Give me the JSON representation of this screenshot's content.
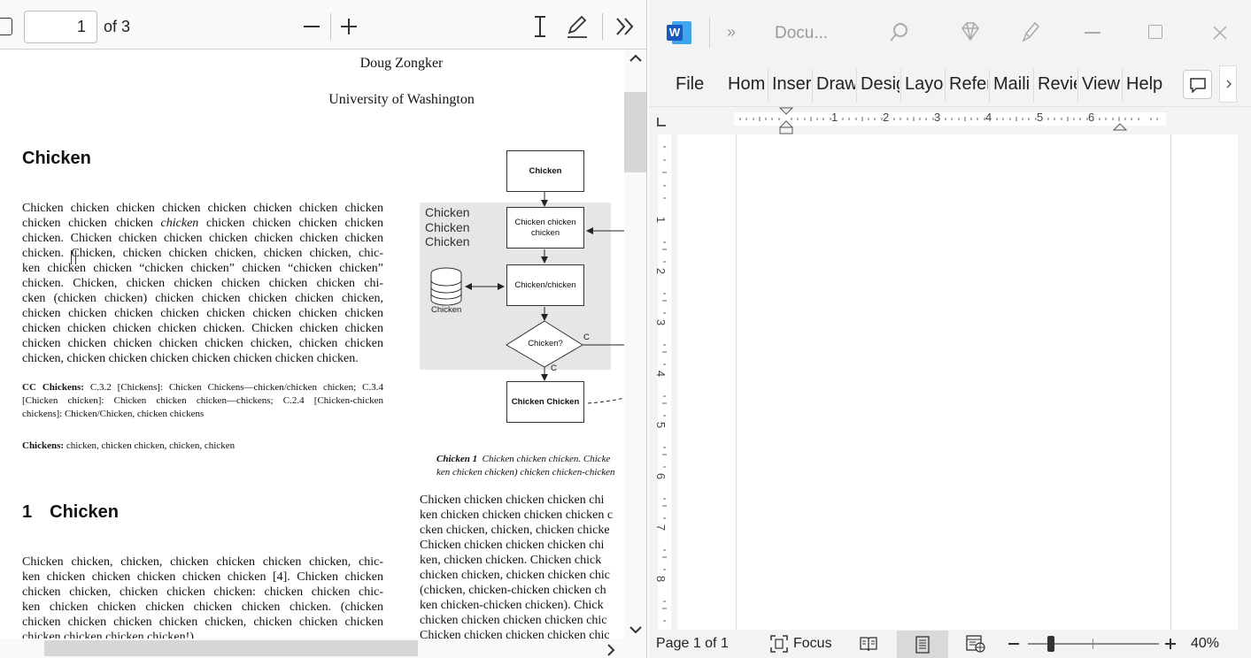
{
  "pdf_viewer": {
    "toolbar": {
      "page_number": "1",
      "page_total": "of 3"
    },
    "document": {
      "author": "Doug Zongker",
      "affiliation": "University of Washington",
      "heading_chicken": "Chicken",
      "abstract": {
        "lines": [
          "Chicken chicken chicken chicken chicken chicken chicken chicken",
          "chicken chicken chicken ",
          "chicken",
          " chicken chicken chicken chicken",
          "chicken. Chicken chicken chicken chicken chicken chicken chicken",
          "chicken. Chicken, chicken chicken chicken, chicken chicken, chic-",
          "ken chicken chicken “chicken chicken” chicken “chicken chicken”",
          "chicken.  Chicken, chicken chicken chicken chicken chicken chi-",
          "cken (chicken chicken) chicken chicken chicken chicken chicken,",
          "chicken chicken chicken chicken chicken chicken chicken chicken",
          "chicken chicken chicken chicken chicken. Chicken chicken chicken",
          "chicken chicken chicken chicken chicken chicken, chicken chicken",
          "chicken, chicken chicken chicken chicken chicken chicken chicken."
        ]
      },
      "cc_label": "CC Chickens:",
      "cc_text_lines": [
        " C.3.2 [Chickens]: Chicken Chickens—chicken/chicken chicken; C.3.4",
        "[Chicken chicken]:  Chicken chicken chicken—chickens;  C.2.4  [Chicken-chicken",
        "chickens]: Chicken/Chicken, chicken chickens"
      ],
      "keywords_label": "Chickens:",
      "keywords_text": " chicken, chicken chicken, chicken, chicken",
      "section_number": "1",
      "section_title": "Chicken",
      "section_lines": [
        "Chicken chicken, chicken, chicken chicken chicken chicken, chic-",
        "ken chicken chicken chicken chicken chicken [4]. Chicken chicken",
        "chicken chicken, chicken chicken chicken: chicken chicken chic-",
        "ken chicken chicken chicken chicken chicken chicken.  (chicken",
        "chicken chicken chicken chicken chicken, chicken chicken chicken",
        "chicken chicken chicken chicken!)"
      ],
      "figure": {
        "group_label": [
          "Chicken",
          "Chicken",
          "Chicken"
        ],
        "box_top": "Chicken",
        "box_two": "Chicken chicken chicken",
        "db_label": "Chicken",
        "box_three": "Chicken/chicken",
        "decision": "Chicken?",
        "edge_c_right": "C",
        "edge_c_down": "C",
        "box_bottom": "Chicken Chicken",
        "caption_label": "Chicken 1",
        "caption_line1": "Chicken chicken chicken.  Chicke",
        "caption_line2": "ken chicken chicken) chicken chicken-chicken"
      },
      "right_column_lines": [
        "Chicken chicken chicken chicken chi",
        "ken chicken chicken chicken chicken c",
        "cken chicken, chicken, chicken chicke",
        "Chicken chicken chicken chicken chi",
        "ken, chicken chicken.  Chicken chick",
        "chicken chicken, chicken chicken chic",
        "(chicken, chicken-chicken chicken ch",
        "ken chicken-chicken chicken).  Chick",
        "chicken chicken chicken chicken chic",
        "Chicken chicken chicken chicken chic"
      ]
    }
  },
  "word": {
    "title": "Docu...",
    "menu_tabs": [
      "File",
      "Hom",
      "Inser",
      "Draw",
      "Desig",
      "Layo",
      "Refer",
      "Maili",
      "Revie",
      "View",
      "Help"
    ],
    "ruler_numbers": [
      "1",
      "2",
      "3",
      "4",
      "5",
      "6"
    ],
    "vertical_ruler_numbers": [
      "1",
      "2",
      "3",
      "4",
      "5",
      "6",
      "7",
      "8"
    ],
    "status": {
      "page": "Page 1 of 1",
      "focus": "Focus",
      "zoom": "40%"
    }
  },
  "colors": {
    "word_blue": "#185abd",
    "toolbar_bg": "#f9f9f9",
    "figure_bg": "#e6e6e6"
  }
}
